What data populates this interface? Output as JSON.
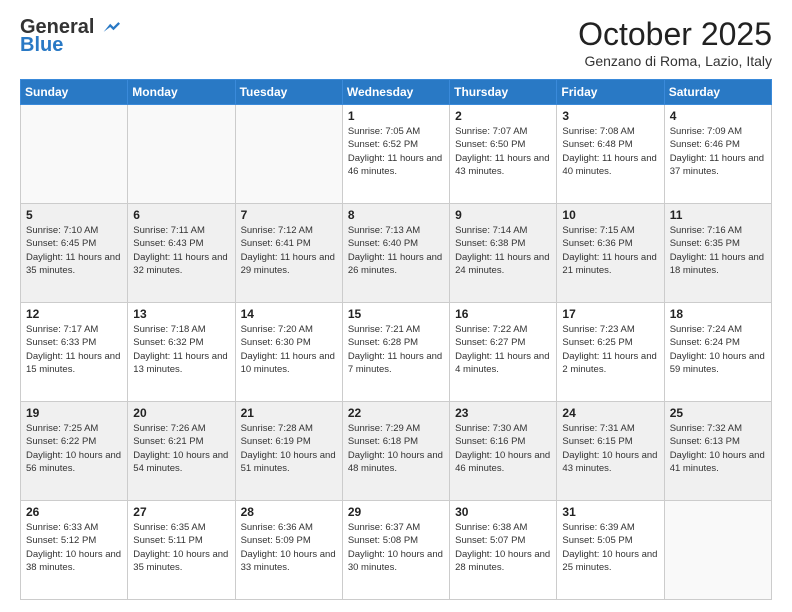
{
  "logo": {
    "line1": "General",
    "line2": "Blue"
  },
  "header": {
    "month": "October 2025",
    "location": "Genzano di Roma, Lazio, Italy"
  },
  "days_of_week": [
    "Sunday",
    "Monday",
    "Tuesday",
    "Wednesday",
    "Thursday",
    "Friday",
    "Saturday"
  ],
  "weeks": [
    [
      {
        "day": "",
        "info": ""
      },
      {
        "day": "",
        "info": ""
      },
      {
        "day": "",
        "info": ""
      },
      {
        "day": "1",
        "info": "Sunrise: 7:05 AM\nSunset: 6:52 PM\nDaylight: 11 hours and 46 minutes."
      },
      {
        "day": "2",
        "info": "Sunrise: 7:07 AM\nSunset: 6:50 PM\nDaylight: 11 hours and 43 minutes."
      },
      {
        "day": "3",
        "info": "Sunrise: 7:08 AM\nSunset: 6:48 PM\nDaylight: 11 hours and 40 minutes."
      },
      {
        "day": "4",
        "info": "Sunrise: 7:09 AM\nSunset: 6:46 PM\nDaylight: 11 hours and 37 minutes."
      }
    ],
    [
      {
        "day": "5",
        "info": "Sunrise: 7:10 AM\nSunset: 6:45 PM\nDaylight: 11 hours and 35 minutes."
      },
      {
        "day": "6",
        "info": "Sunrise: 7:11 AM\nSunset: 6:43 PM\nDaylight: 11 hours and 32 minutes."
      },
      {
        "day": "7",
        "info": "Sunrise: 7:12 AM\nSunset: 6:41 PM\nDaylight: 11 hours and 29 minutes."
      },
      {
        "day": "8",
        "info": "Sunrise: 7:13 AM\nSunset: 6:40 PM\nDaylight: 11 hours and 26 minutes."
      },
      {
        "day": "9",
        "info": "Sunrise: 7:14 AM\nSunset: 6:38 PM\nDaylight: 11 hours and 24 minutes."
      },
      {
        "day": "10",
        "info": "Sunrise: 7:15 AM\nSunset: 6:36 PM\nDaylight: 11 hours and 21 minutes."
      },
      {
        "day": "11",
        "info": "Sunrise: 7:16 AM\nSunset: 6:35 PM\nDaylight: 11 hours and 18 minutes."
      }
    ],
    [
      {
        "day": "12",
        "info": "Sunrise: 7:17 AM\nSunset: 6:33 PM\nDaylight: 11 hours and 15 minutes."
      },
      {
        "day": "13",
        "info": "Sunrise: 7:18 AM\nSunset: 6:32 PM\nDaylight: 11 hours and 13 minutes."
      },
      {
        "day": "14",
        "info": "Sunrise: 7:20 AM\nSunset: 6:30 PM\nDaylight: 11 hours and 10 minutes."
      },
      {
        "day": "15",
        "info": "Sunrise: 7:21 AM\nSunset: 6:28 PM\nDaylight: 11 hours and 7 minutes."
      },
      {
        "day": "16",
        "info": "Sunrise: 7:22 AM\nSunset: 6:27 PM\nDaylight: 11 hours and 4 minutes."
      },
      {
        "day": "17",
        "info": "Sunrise: 7:23 AM\nSunset: 6:25 PM\nDaylight: 11 hours and 2 minutes."
      },
      {
        "day": "18",
        "info": "Sunrise: 7:24 AM\nSunset: 6:24 PM\nDaylight: 10 hours and 59 minutes."
      }
    ],
    [
      {
        "day": "19",
        "info": "Sunrise: 7:25 AM\nSunset: 6:22 PM\nDaylight: 10 hours and 56 minutes."
      },
      {
        "day": "20",
        "info": "Sunrise: 7:26 AM\nSunset: 6:21 PM\nDaylight: 10 hours and 54 minutes."
      },
      {
        "day": "21",
        "info": "Sunrise: 7:28 AM\nSunset: 6:19 PM\nDaylight: 10 hours and 51 minutes."
      },
      {
        "day": "22",
        "info": "Sunrise: 7:29 AM\nSunset: 6:18 PM\nDaylight: 10 hours and 48 minutes."
      },
      {
        "day": "23",
        "info": "Sunrise: 7:30 AM\nSunset: 6:16 PM\nDaylight: 10 hours and 46 minutes."
      },
      {
        "day": "24",
        "info": "Sunrise: 7:31 AM\nSunset: 6:15 PM\nDaylight: 10 hours and 43 minutes."
      },
      {
        "day": "25",
        "info": "Sunrise: 7:32 AM\nSunset: 6:13 PM\nDaylight: 10 hours and 41 minutes."
      }
    ],
    [
      {
        "day": "26",
        "info": "Sunrise: 6:33 AM\nSunset: 5:12 PM\nDaylight: 10 hours and 38 minutes."
      },
      {
        "day": "27",
        "info": "Sunrise: 6:35 AM\nSunset: 5:11 PM\nDaylight: 10 hours and 35 minutes."
      },
      {
        "day": "28",
        "info": "Sunrise: 6:36 AM\nSunset: 5:09 PM\nDaylight: 10 hours and 33 minutes."
      },
      {
        "day": "29",
        "info": "Sunrise: 6:37 AM\nSunset: 5:08 PM\nDaylight: 10 hours and 30 minutes."
      },
      {
        "day": "30",
        "info": "Sunrise: 6:38 AM\nSunset: 5:07 PM\nDaylight: 10 hours and 28 minutes."
      },
      {
        "day": "31",
        "info": "Sunrise: 6:39 AM\nSunset: 5:05 PM\nDaylight: 10 hours and 25 minutes."
      },
      {
        "day": "",
        "info": ""
      }
    ]
  ]
}
